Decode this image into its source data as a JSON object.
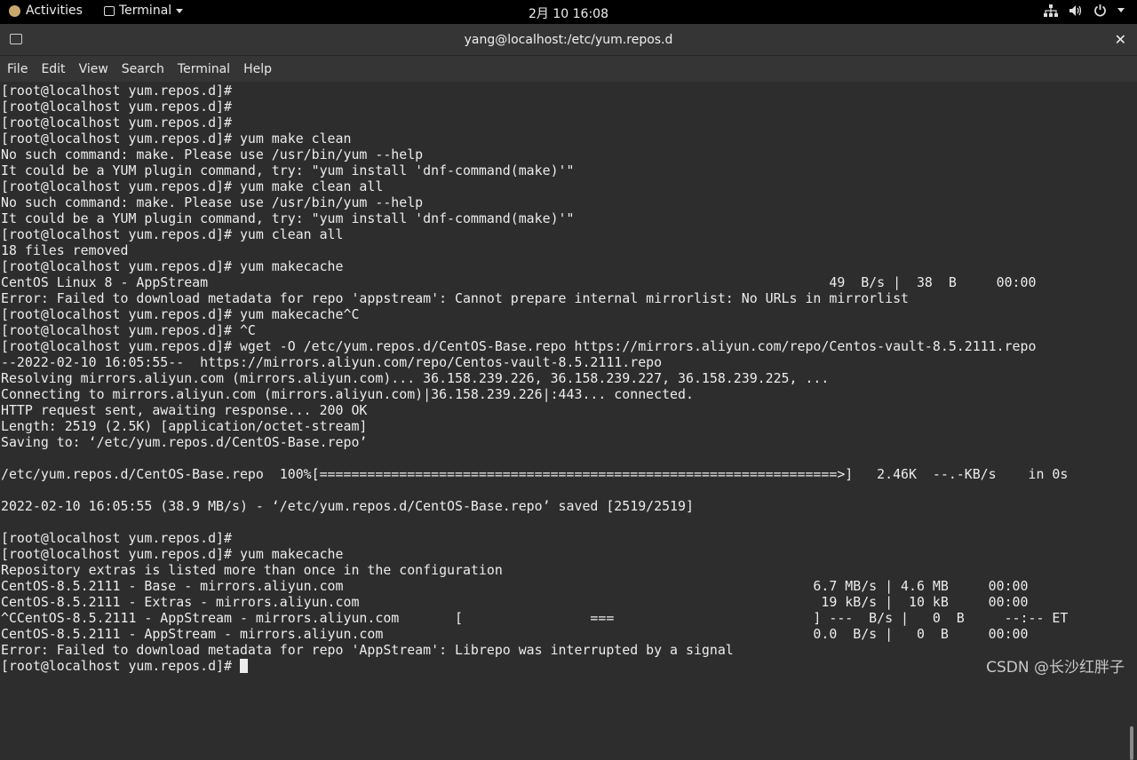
{
  "topbar": {
    "activities": "Activities",
    "app_name": "Terminal",
    "clock": "2月 10  16:08"
  },
  "window": {
    "title": "yang@localhost:/etc/yum.repos.d",
    "close_glyph": "✕"
  },
  "menu": [
    "File",
    "Edit",
    "View",
    "Search",
    "Terminal",
    "Help"
  ],
  "terminal": {
    "lines": [
      "[root@localhost yum.repos.d]#",
      "[root@localhost yum.repos.d]#",
      "[root@localhost yum.repos.d]#",
      "[root@localhost yum.repos.d]# yum make clean",
      "No such command: make. Please use /usr/bin/yum --help",
      "It could be a YUM plugin command, try: \"yum install 'dnf-command(make)'\"",
      "[root@localhost yum.repos.d]# yum make clean all",
      "No such command: make. Please use /usr/bin/yum --help",
      "It could be a YUM plugin command, try: \"yum install 'dnf-command(make)'\"",
      "[root@localhost yum.repos.d]# yum clean all",
      "18 files removed",
      "[root@localhost yum.repos.d]# yum makecache",
      "CentOS Linux 8 - AppStream                                                                              49  B/s |  38  B     00:00",
      "Error: Failed to download metadata for repo 'appstream': Cannot prepare internal mirrorlist: No URLs in mirrorlist",
      "[root@localhost yum.repos.d]# yum makecache^C",
      "[root@localhost yum.repos.d]# ^C",
      "[root@localhost yum.repos.d]# wget -O /etc/yum.repos.d/CentOS-Base.repo https://mirrors.aliyun.com/repo/Centos-vault-8.5.2111.repo",
      "--2022-02-10 16:05:55--  https://mirrors.aliyun.com/repo/Centos-vault-8.5.2111.repo",
      "Resolving mirrors.aliyun.com (mirrors.aliyun.com)... 36.158.239.226, 36.158.239.227, 36.158.239.225, ...",
      "Connecting to mirrors.aliyun.com (mirrors.aliyun.com)|36.158.239.226|:443... connected.",
      "HTTP request sent, awaiting response... 200 OK",
      "Length: 2519 (2.5K) [application/octet-stream]",
      "Saving to: ‘/etc/yum.repos.d/CentOS-Base.repo’",
      "",
      "/etc/yum.repos.d/CentOS-Base.repo  100%[=================================================================>]   2.46K  --.-KB/s    in 0s",
      "",
      "2022-02-10 16:05:55 (38.9 MB/s) - ‘/etc/yum.repos.d/CentOS-Base.repo’ saved [2519/2519]",
      "",
      "[root@localhost yum.repos.d]#",
      "[root@localhost yum.repos.d]# yum makecache",
      "Repository extras is listed more than once in the configuration",
      "CentOS-8.5.2111 - Base - mirrors.aliyun.com                                                           6.7 MB/s | 4.6 MB     00:00",
      "CentOS-8.5.2111 - Extras - mirrors.aliyun.com                                                          19 kB/s |  10 kB     00:00",
      "^CCentOS-8.5.2111 - AppStream - mirrors.aliyun.com       [                ===                         ] ---  B/s |   0  B     --:-- ET",
      "CentOS-8.5.2111 - AppStream - mirrors.aliyun.com                                                      0.0  B/s |   0  B     00:00",
      "Error: Failed to download metadata for repo 'AppStream': Librepo was interrupted by a signal"
    ],
    "prompt": "[root@localhost yum.repos.d]# "
  },
  "watermark": "CSDN @长沙红胖子"
}
